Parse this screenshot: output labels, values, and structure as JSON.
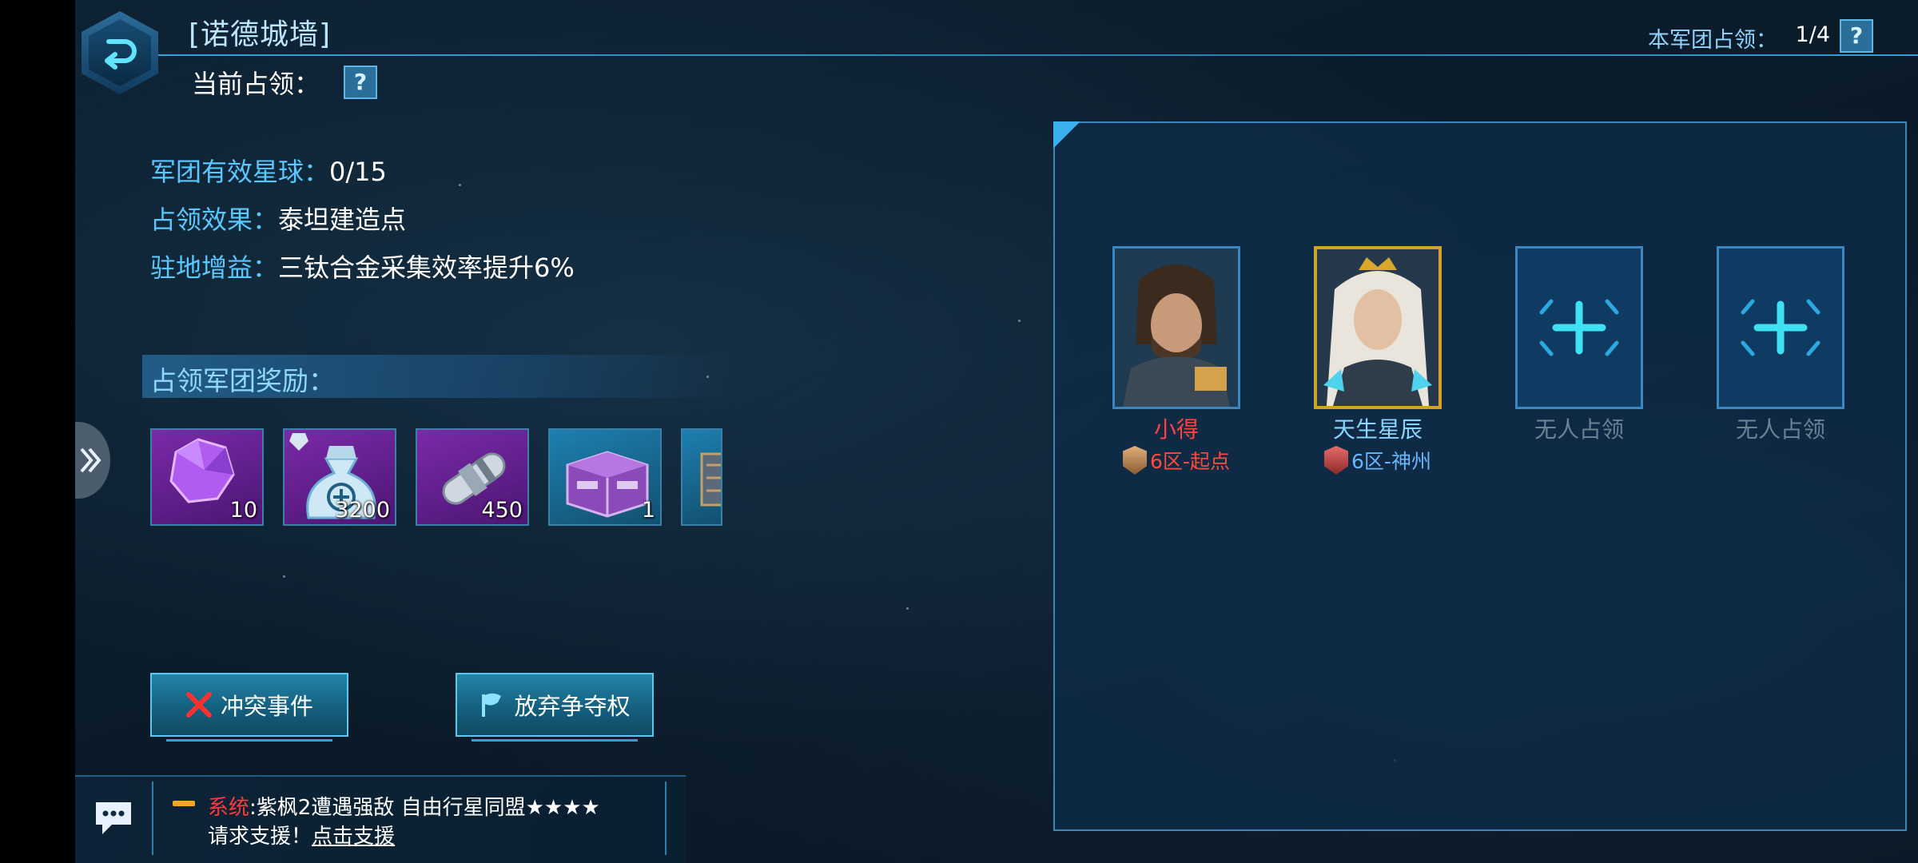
{
  "header": {
    "title": "[诺德城墙]",
    "current_occupy_label": "当前占领：",
    "help_glyph": "?",
    "legion_occupy_label": "本军团占领：",
    "legion_occupy_count": "1/4"
  },
  "info": {
    "planets_label": "军团有效星球：",
    "planets_value": "0/15",
    "effect_label": "占领效果：",
    "effect_value": "泰坦建造点",
    "buff_label": "驻地增益：",
    "buff_value": "三钛合金采集效率提升6%"
  },
  "rewards": {
    "title": "占领军团奖励：",
    "items": [
      {
        "icon": "purple-crystal-icon",
        "count": "10"
      },
      {
        "icon": "money-bag-icon",
        "count": "3200"
      },
      {
        "icon": "capsule-icon",
        "count": "450"
      },
      {
        "icon": "supply-crate-icon",
        "count": "1"
      },
      {
        "icon": "partial-item-icon",
        "count": ""
      }
    ]
  },
  "actions": {
    "conflict_label": "冲突事件",
    "abandon_label": "放弃争夺权"
  },
  "chat": {
    "sys_label": "系统",
    "message_line1": ":紫枫2遭遇强敌 自由行星同盟★★★★",
    "message_line2_prefix": "请求支援！",
    "message_link": "点击支援"
  },
  "slots": [
    {
      "name": "小得",
      "server": "6区-起点",
      "state": "occupied"
    },
    {
      "name": "天生星辰",
      "server": "6区-神州",
      "state": "occupied"
    },
    {
      "name": "无人占领",
      "server": "",
      "state": "empty"
    },
    {
      "name": "无人占领",
      "server": "",
      "state": "empty"
    }
  ],
  "colors": {
    "accent_cyan": "#59c8ff",
    "enemy_red": "#ff4040",
    "gold_frame": "#d2a22c"
  }
}
